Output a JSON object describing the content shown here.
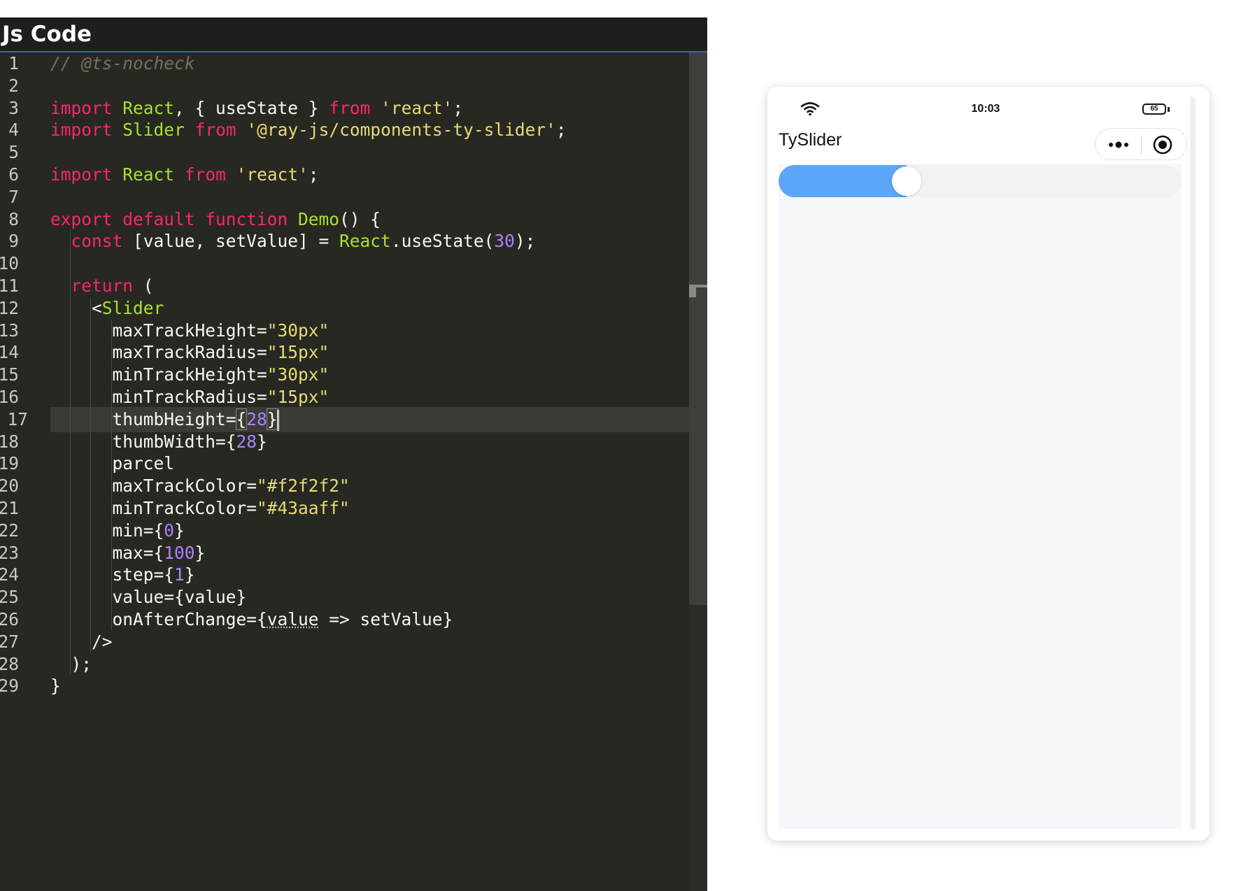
{
  "editor": {
    "title": "Js Code",
    "lines": [
      {
        "n": "1",
        "html": "<span class=\"cm\">// @ts-nocheck</span>"
      },
      {
        "n": "2",
        "html": ""
      },
      {
        "n": "3",
        "html": "<span class=\"kw\">import</span> <span class=\"fn\">React</span>, { useState } <span class=\"kw\">from</span> <span class=\"st\">'react'</span>;"
      },
      {
        "n": "4",
        "html": "<span class=\"kw\">import</span> <span class=\"fn\">Slider</span> <span class=\"kw\">from</span> <span class=\"st\">'@ray-js/components-ty-slider'</span>;"
      },
      {
        "n": "5",
        "html": ""
      },
      {
        "n": "6",
        "html": "<span class=\"kw\">import</span> <span class=\"fn\">React</span> <span class=\"kw\">from</span> <span class=\"st\">'react'</span>;"
      },
      {
        "n": "7",
        "html": ""
      },
      {
        "n": "8",
        "html": "<span class=\"kw\">export default function</span> <span class=\"fn\">Demo</span>() {"
      },
      {
        "n": "9",
        "html": "  <span class=\"kw\">const</span> [value, setValue] = <span class=\"fn\">React</span>.useState(<span class=\"nu\">30</span>);"
      },
      {
        "n": "10",
        "html": ""
      },
      {
        "n": "11",
        "html": "  <span class=\"kw\">return</span> ("
      },
      {
        "n": "12",
        "html": "    &lt;<span class=\"fn\">Slider</span>"
      },
      {
        "n": "13",
        "html": "      maxTrackHeight=<span class=\"st\">\"30px\"</span>"
      },
      {
        "n": "14",
        "html": "      maxTrackRadius=<span class=\"st\">\"15px\"</span>"
      },
      {
        "n": "15",
        "html": "      minTrackHeight=<span class=\"st\">\"30px\"</span>"
      },
      {
        "n": "16",
        "html": "      minTrackRadius=<span class=\"st\">\"15px\"</span>"
      },
      {
        "n": "17",
        "html": "      thumbHeight=<span class=\"bm\">{</span><span class=\"nu\">28</span><span class=\"bm\">}</span><span class=\"caret\"></span>"
      },
      {
        "n": "18",
        "html": "      thumbWidth={<span class=\"nu\">28</span>}"
      },
      {
        "n": "19",
        "html": "      parcel"
      },
      {
        "n": "20",
        "html": "      maxTrackColor=<span class=\"st\">\"#f2f2f2\"</span>"
      },
      {
        "n": "21",
        "html": "      minTrackColor=<span class=\"st\">\"#43aaff\"</span>"
      },
      {
        "n": "22",
        "html": "      min={<span class=\"nu\">0</span>}"
      },
      {
        "n": "23",
        "html": "      max={<span class=\"nu\">100</span>}"
      },
      {
        "n": "24",
        "html": "      step={<span class=\"nu\">1</span>}"
      },
      {
        "n": "25",
        "html": "      value={value}"
      },
      {
        "n": "26",
        "html": "      onAfterChange={<span class=\"dots\">value</span> =&gt; setValue}"
      },
      {
        "n": "27",
        "html": "    /&gt;"
      },
      {
        "n": "28",
        "html": "  );"
      },
      {
        "n": "29",
        "html": "}"
      }
    ],
    "active_line": 17
  },
  "preview": {
    "status_time": "10:03",
    "battery_level": "65",
    "nav_title": "TySlider",
    "slider": {
      "value": 30,
      "min": 0,
      "max": 100,
      "min_track_color": "#5ba6f7",
      "max_track_color": "#f2f2f2"
    }
  },
  "icons": {
    "wifi": "wifi-icon",
    "battery": "battery-icon",
    "more": "more-options-icon",
    "close": "close-miniapp-icon"
  }
}
